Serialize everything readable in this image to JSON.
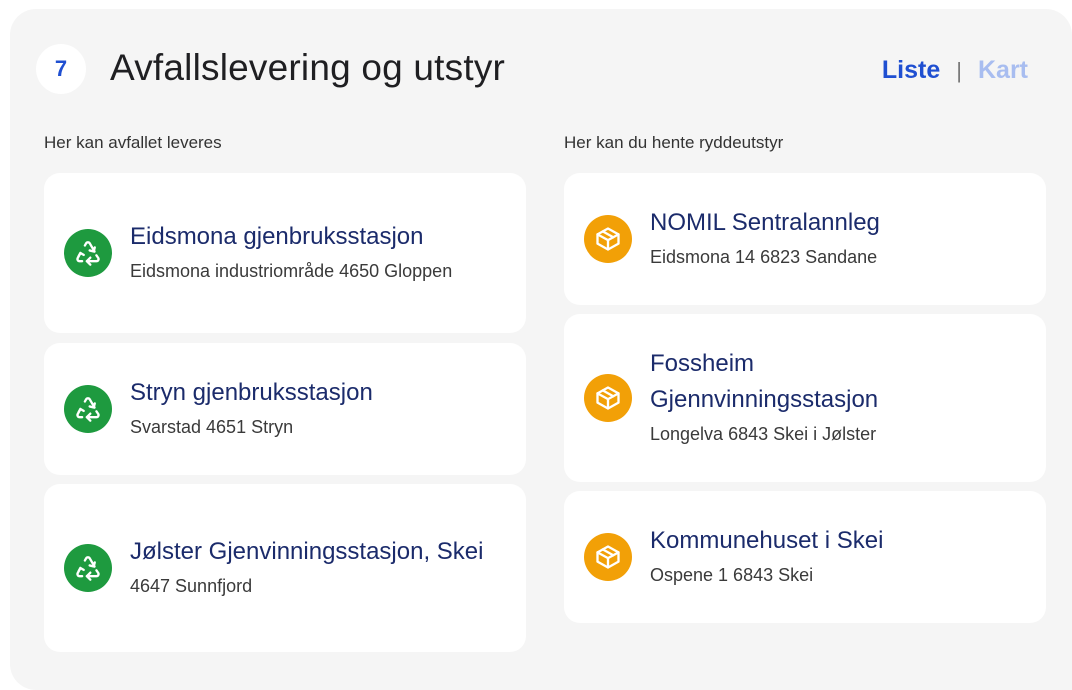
{
  "header": {
    "step": "7",
    "title": "Avfallslevering og utstyr",
    "view_list": "Liste",
    "view_sep": "|",
    "view_map": "Kart"
  },
  "left": {
    "label": "Her kan avfallet leveres",
    "icon": "recycle-icon",
    "items": [
      {
        "name": "Eidsmona gjenbruksstasjon",
        "address": "Eidsmona industriområde 4650 Gloppen"
      },
      {
        "name": "Stryn gjenbruksstasjon",
        "address": "Svarstad 4651 Stryn"
      },
      {
        "name": "Jølster Gjenvinningsstasjon, Skei",
        "address": "4647 Sunnfjord"
      }
    ]
  },
  "right": {
    "label": "Her kan du hente ryddeutstyr",
    "icon": "box-icon",
    "items": [
      {
        "name": "NOMIL Sentralannleg",
        "address": "Eidsmona 14 6823 Sandane"
      },
      {
        "name": "Fossheim Gjennvinningsstasjon",
        "address": "Longelva 6843 Skei i Jølster"
      },
      {
        "name": "Kommunehuset i Skei",
        "address": "Ospene 1 6843 Skei"
      }
    ]
  },
  "colors": {
    "accent": "#1f4fd1",
    "recycle": "#1e9a3f",
    "box": "#f2a007",
    "panel": "#f5f5f5"
  }
}
